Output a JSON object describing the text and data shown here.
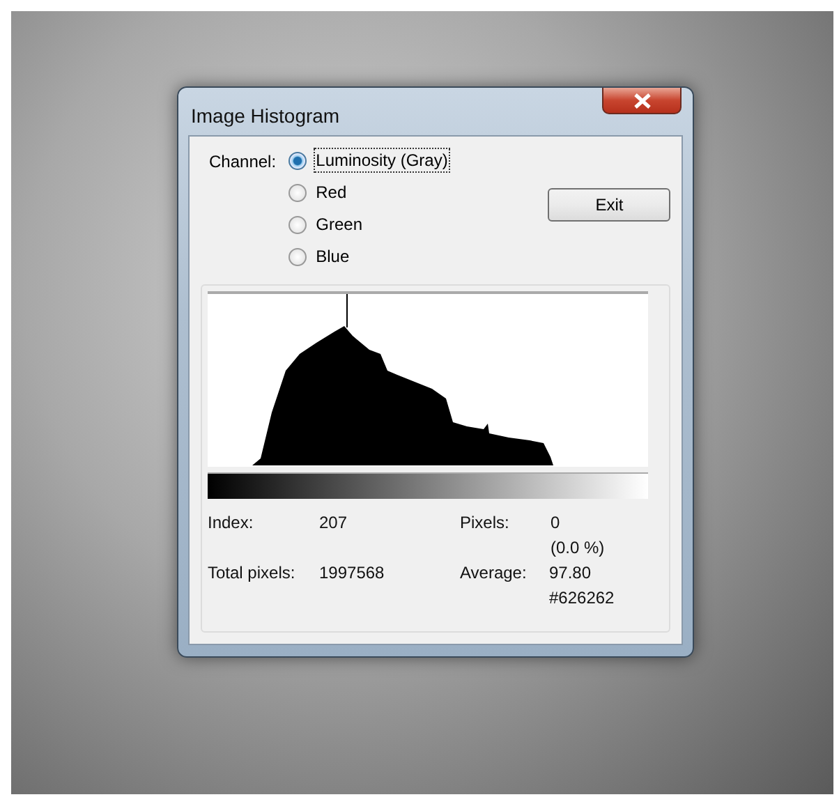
{
  "window": {
    "title": "Image Histogram"
  },
  "channel_label": "Channel:",
  "channels": [
    {
      "label": "Luminosity (Gray)",
      "selected": true
    },
    {
      "label": "Red",
      "selected": false
    },
    {
      "label": "Green",
      "selected": false
    },
    {
      "label": "Blue",
      "selected": false
    }
  ],
  "buttons": [
    "Exit"
  ],
  "stats": [
    {
      "label": "Index:",
      "value": "207"
    },
    {
      "label": "Pixels:",
      "value": "0",
      "extra": "(0.0 %)"
    },
    {
      "label": "Total pixels:",
      "value": "1997568"
    },
    {
      "label": "Average:",
      "value": "97.80",
      "extra": "#626262"
    }
  ]
}
